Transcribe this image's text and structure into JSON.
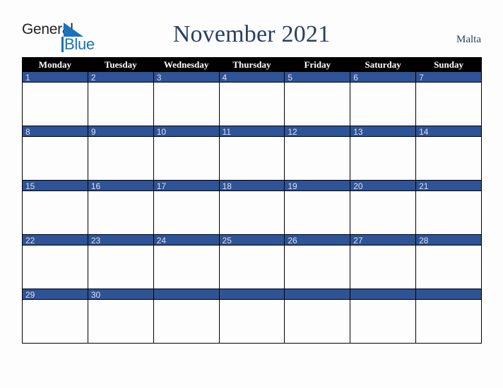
{
  "brand": {
    "name_part1": "General",
    "name_part2": "Blue",
    "triangle_color": "#1a72bb",
    "text_color_part1": "#231f20",
    "text_color_part2": "#1a72bb"
  },
  "header": {
    "title": "November 2021",
    "region": "Malta",
    "title_color": "#2a3f62"
  },
  "calendar": {
    "month": "November",
    "year": "2021",
    "week_start": "Monday",
    "header_bg": "#000000",
    "header_fg": "#ffffff",
    "daynum_bg": "#2e5396",
    "daynum_fg": "#dbe2ef",
    "cell_bg": "#fdfdfd",
    "border_color": "#000000",
    "weekdays": [
      "Monday",
      "Tuesday",
      "Wednesday",
      "Thursday",
      "Friday",
      "Saturday",
      "Sunday"
    ],
    "weeks": [
      [
        "1",
        "2",
        "3",
        "4",
        "5",
        "6",
        "7"
      ],
      [
        "8",
        "9",
        "10",
        "11",
        "12",
        "13",
        "14"
      ],
      [
        "15",
        "16",
        "17",
        "18",
        "19",
        "20",
        "21"
      ],
      [
        "22",
        "23",
        "24",
        "25",
        "26",
        "27",
        "28"
      ],
      [
        "29",
        "30",
        "",
        "",
        "",
        "",
        ""
      ]
    ]
  }
}
